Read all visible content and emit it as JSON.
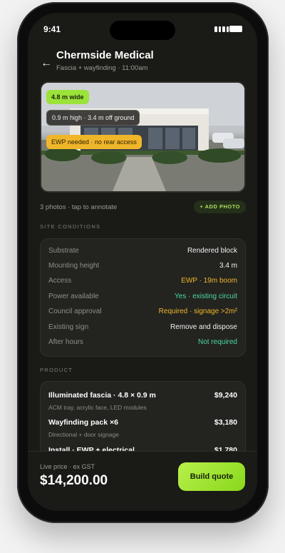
{
  "status_bar": {
    "time": "9:41"
  },
  "header": {
    "back_icon": "arrow-left-icon",
    "title": "Chermside Medical",
    "subtitle": "Fascia + wayfinding · 11:00am"
  },
  "photo": {
    "chips": {
      "width": "4.8 m wide",
      "height": "0.9 m high · 3.4 m off ground",
      "access": "EWP needed · no rear access"
    }
  },
  "photos_meta": {
    "count_text": "3 photos · tap to annotate",
    "add_button": "+ ADD PHOTO"
  },
  "site_conditions": {
    "label": "SITE CONDITIONS",
    "rows": [
      {
        "key": "Substrate",
        "value": "Rendered block",
        "color": "#f0f0f0"
      },
      {
        "key": "Mounting height",
        "value": "3.4 m",
        "color": "#f0f0f0"
      },
      {
        "key": "Access",
        "value": "EWP · 19m boom",
        "color": "#f0b62a"
      },
      {
        "key": "Power available",
        "value": "Yes · existing circuit",
        "color": "#4ed8a0"
      },
      {
        "key": "Council approval",
        "value": "Required · signage >2m²",
        "color": "#f0b62a"
      },
      {
        "key": "Existing sign",
        "value": "Remove and dispose",
        "color": "#f0f0f0"
      },
      {
        "key": "After hours",
        "value": "Not required",
        "color": "#4ed8a0"
      }
    ]
  },
  "product": {
    "label": "PRODUCT",
    "items": [
      {
        "name": "Illuminated fascia · 4.8 × 0.9 m",
        "price": "$9,240",
        "desc": "ACM tray, acrylic face, LED modules"
      },
      {
        "name": "Wayfinding pack ×6",
        "price": "$3,180",
        "desc": "Directional + door signage"
      },
      {
        "name": "Install · EWP + electrical",
        "price": "$1,780",
        "desc": ""
      }
    ]
  },
  "footer": {
    "price_label": "Live price · ex GST",
    "price_value": "$14,200.00",
    "build_button": "Build quote"
  },
  "colors": {
    "accent_green": "#9be23a",
    "warning": "#f0b62a",
    "success": "#4ed8a0",
    "background": "#1a1b17"
  }
}
